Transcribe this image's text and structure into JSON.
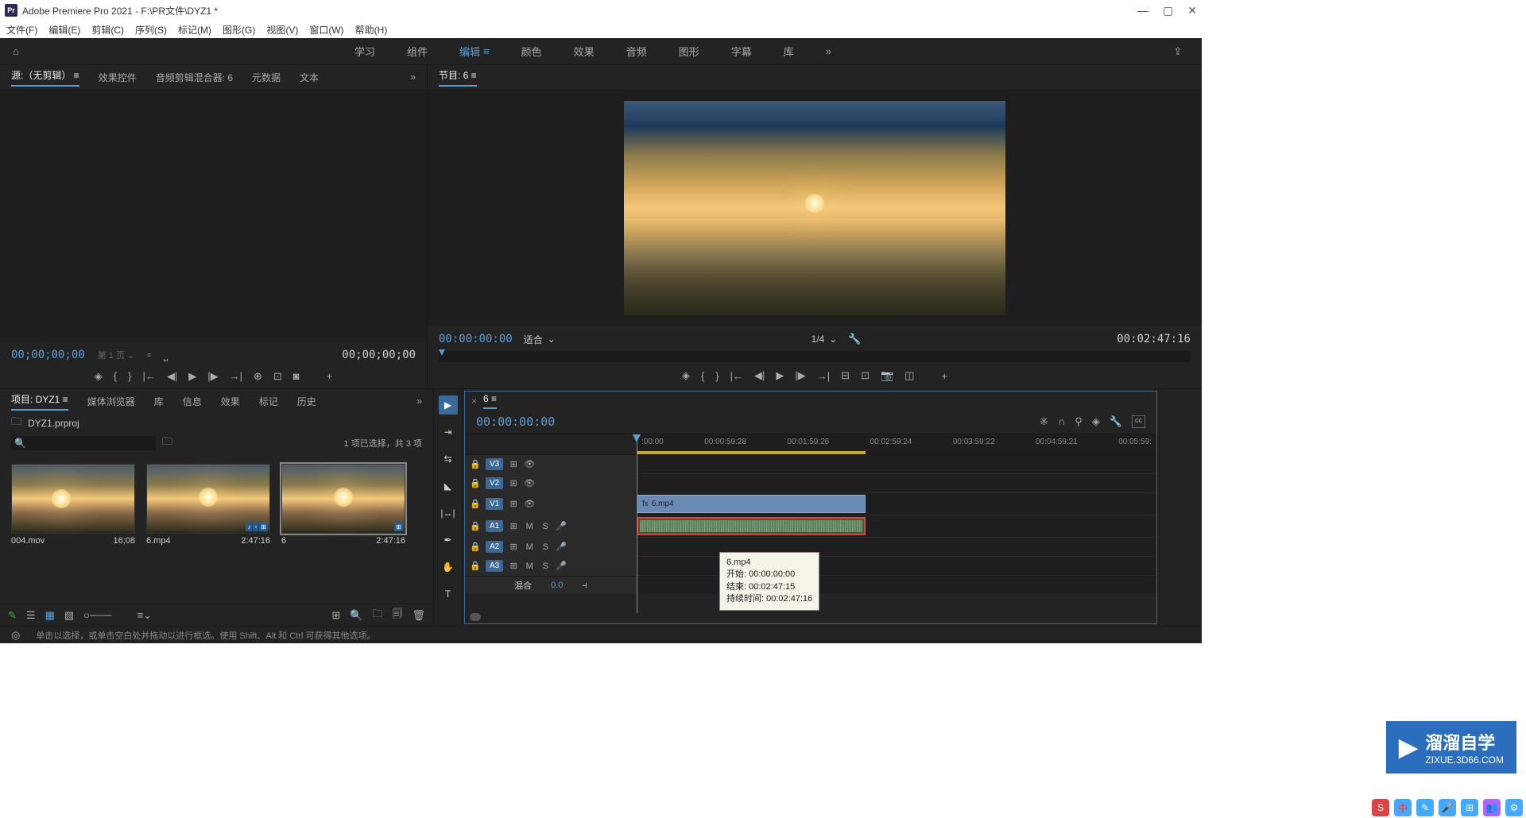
{
  "titlebar": {
    "app": "Adobe Premiere Pro 2021",
    "sep": " - ",
    "path": "F:\\PR文件\\DYZ1 *"
  },
  "menubar": [
    "文件(F)",
    "编辑(E)",
    "剪辑(C)",
    "序列(S)",
    "标记(M)",
    "图形(G)",
    "视图(V)",
    "窗口(W)",
    "帮助(H)"
  ],
  "workspaces": {
    "items": [
      "学习",
      "组件",
      "编辑",
      "颜色",
      "效果",
      "音频",
      "图形",
      "字幕",
      "库"
    ],
    "active": "编辑"
  },
  "source": {
    "tabs": [
      "源:（无剪辑）",
      "效果控件",
      "音频剪辑混合器: 6",
      "元数据",
      "文本"
    ],
    "active": 0,
    "tc_left": "00;00;00;00",
    "pager": "第 1 页",
    "tc_right": "00;00;00;00"
  },
  "program": {
    "title": "节目: 6",
    "tc_left": "00:00:00:00",
    "fit": "适合",
    "scale": "1/4",
    "tc_right": "00:02:47:16"
  },
  "project": {
    "tabs": [
      "项目: DYZ1",
      "媒体浏览器",
      "库",
      "信息",
      "效果",
      "标记",
      "历史"
    ],
    "active": 0,
    "file": "DYZ1.prproj",
    "status": "1 项已选择，共 3 项",
    "clips": [
      {
        "name": "004.mov",
        "dur": "16;08",
        "selected": false,
        "badges": []
      },
      {
        "name": "6.mp4",
        "dur": "2:47:16",
        "selected": false,
        "badges": [
          "a",
          "v",
          "b"
        ]
      },
      {
        "name": "6",
        "dur": "2:47:16",
        "selected": true,
        "badges": [
          "s"
        ]
      }
    ]
  },
  "timeline": {
    "seq_name": "6",
    "tc": "00:00:00:00",
    "ticks": [
      ":00:00",
      "00:00:59:28",
      "00:01:59:26",
      "00:02:59:24",
      "00:03:59:22",
      "00:04:59:21",
      "00:05:59:"
    ],
    "v_tracks": [
      {
        "name": "V3"
      },
      {
        "name": "V2"
      },
      {
        "name": "V1",
        "clip": {
          "name": "6.mp4"
        }
      }
    ],
    "a_tracks": [
      {
        "name": "A1",
        "clip": true
      },
      {
        "name": "A2"
      },
      {
        "name": "A3"
      }
    ],
    "mix": {
      "label": "混合",
      "value": "0.0"
    }
  },
  "tooltip": {
    "name": "6.mp4",
    "start_l": "开始:",
    "start_v": "00:00:00:00",
    "end_l": "结束:",
    "end_v": "00:02:47:15",
    "dur_l": "持续时间:",
    "dur_v": "00:02:47:16"
  },
  "watermark": {
    "text1": "溜溜自学",
    "text2": "ZIXUE.3D66.COM"
  },
  "status": {
    "hint": "单击以选择，或单击空白处并拖动以进行框选。使用 Shift、Alt 和 Ctrl 可获得其他选项。"
  }
}
